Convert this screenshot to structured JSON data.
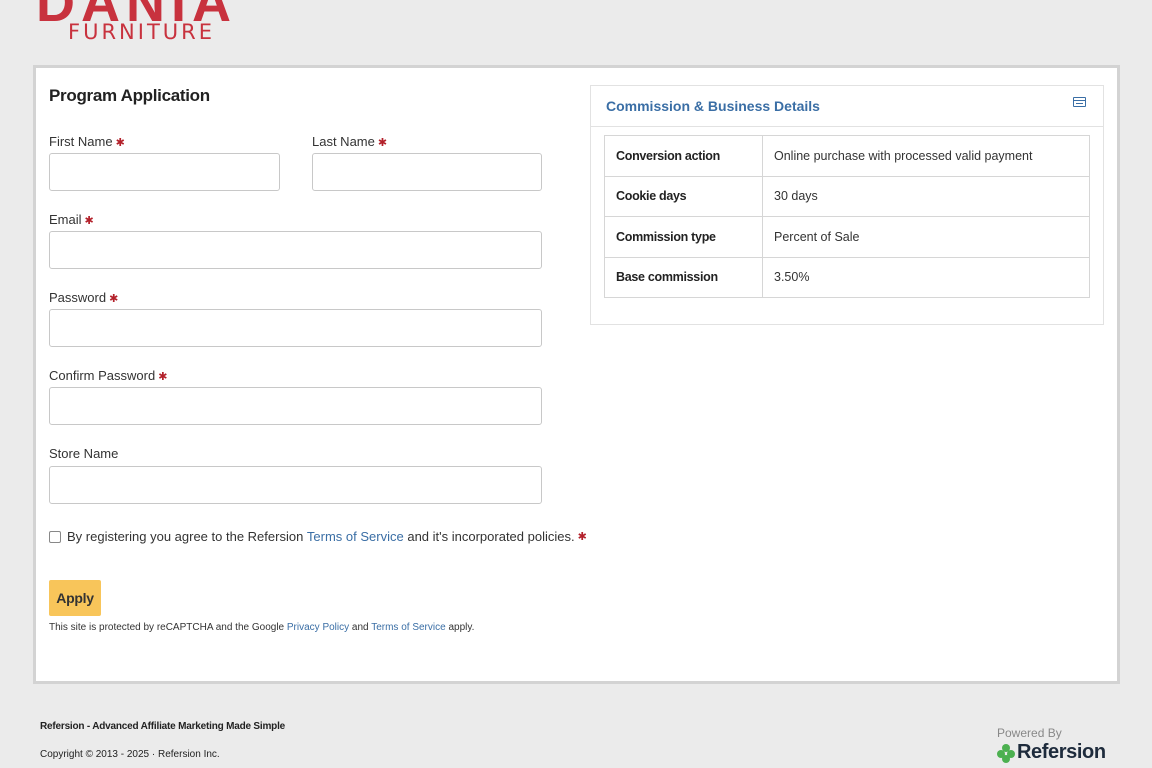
{
  "brand": {
    "name": "DANIA",
    "subtitle": "FURNITURE",
    "accent_color": "#c8323e"
  },
  "form": {
    "title": "Program Application",
    "required_marker": "✱",
    "fields": {
      "first_name": {
        "label": "First Name",
        "value": "",
        "required": true
      },
      "last_name": {
        "label": "Last Name",
        "value": "",
        "required": true
      },
      "email": {
        "label": "Email",
        "value": "",
        "required": true
      },
      "password": {
        "label": "Password",
        "value": "",
        "required": true
      },
      "confirm_password": {
        "label": "Confirm Password",
        "value": "",
        "required": true
      },
      "store_name": {
        "label": "Store Name",
        "value": "",
        "required": false
      }
    },
    "agreement": {
      "prefix": "By registering you agree to the Refersion ",
      "link": "Terms of Service",
      "suffix": " and it's incorporated policies.",
      "checked": false
    },
    "apply_label": "Apply",
    "recaptcha": {
      "prefix": "This site is protected by reCAPTCHA and the Google ",
      "privacy_link": "Privacy Policy",
      "middle": " and ",
      "terms_link": "Terms of Service",
      "suffix": " apply."
    },
    "apply_color": "#f8c55a",
    "link_color": "#3a6ea5"
  },
  "details": {
    "title": "Commission & Business Details",
    "icon": "list-card-icon",
    "rows": [
      {
        "key": "Conversion action",
        "value": "Online purchase with processed valid payment"
      },
      {
        "key": "Cookie days",
        "value": "30 days"
      },
      {
        "key": "Commission type",
        "value": "Percent of Sale"
      },
      {
        "key": "Base commission",
        "value": "3.50%"
      }
    ]
  },
  "footer": {
    "tagline": "Refersion - Advanced Affiliate Marketing Made Simple",
    "copyright": "Copyright © 2013 - 2025 · Refersion Inc.",
    "powered_by": "Powered By",
    "powered_brand": "Refersion",
    "powered_icon": "refersion-logo-icon"
  }
}
